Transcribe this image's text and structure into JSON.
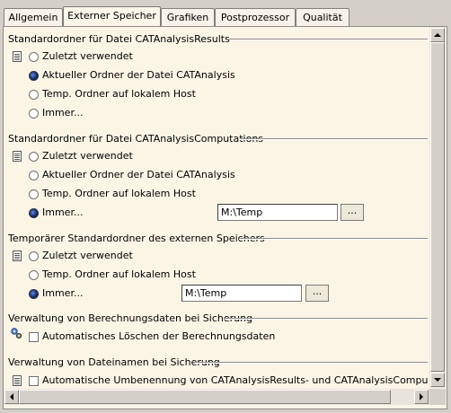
{
  "tabs": [
    {
      "label": "Allgemein"
    },
    {
      "label": "Externer Speicher"
    },
    {
      "label": "Grafiken"
    },
    {
      "label": "Postprozessor"
    },
    {
      "label": "Qualität"
    }
  ],
  "active_tab": "Externer Speicher",
  "section1": {
    "title": "Standardordner für Datei CATAnalysisResults",
    "options": [
      "Zuletzt verwendet",
      "Aktueller Ordner der Datei CATAnalysis",
      "Temp. Ordner auf lokalem Host",
      "Immer..."
    ],
    "selected": "Aktueller Ordner der Datei CATAnalysis"
  },
  "section2": {
    "title": "Standardordner für Datei CATAnalysisComputations",
    "options": [
      "Zuletzt verwendet",
      "Aktueller Ordner der Datei CATAnalysis",
      "Temp. Ordner auf lokalem Host",
      "Immer..."
    ],
    "selected": "Immer...",
    "path_value": "M:\\Temp",
    "browse_label": "..."
  },
  "section3": {
    "title": "Temporärer Standardordner des externen Speichers",
    "options": [
      "Zuletzt verwendet",
      "Temp. Ordner auf lokalem Host",
      "Immer..."
    ],
    "selected": "Immer...",
    "path_value": "M:\\Temp",
    "browse_label": "..."
  },
  "section4": {
    "title": "Verwaltung von Berechnungsdaten bei Sicherung",
    "checkbox_label": "Automatisches Löschen der Berechnungsdaten",
    "checked": false
  },
  "section5": {
    "title": "Verwaltung von Dateinamen bei Sicherung",
    "checkbox_label": "Automatische Umbenennung von CATAnalysisResults- und CATAnalysisComputations-Dateien",
    "checked": false
  }
}
